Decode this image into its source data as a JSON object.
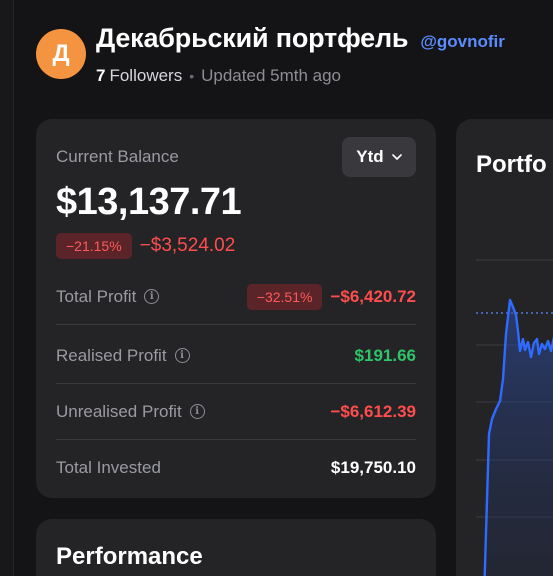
{
  "profile": {
    "avatar_letter": "Д",
    "avatar_color": "#f59440",
    "title": "Декабрьский портфель",
    "handle": "@govnofir",
    "followers_count": "7",
    "followers_label": "Followers",
    "updated": "Updated 5mth ago"
  },
  "balance": {
    "label": "Current Balance",
    "range_selected": "Ytd",
    "value": "$13,137.71",
    "change_pct": "−21.15%",
    "change_abs": "−$3,524.02"
  },
  "stats": [
    {
      "label": "Total Profit",
      "info": true,
      "badge": "−32.51%",
      "value": "−$6,420.72",
      "tone": "neg"
    },
    {
      "label": "Realised Profit",
      "info": true,
      "badge": "",
      "value": "$191.66",
      "tone": "pos"
    },
    {
      "label": "Unrealised Profit",
      "info": true,
      "badge": "",
      "value": "−$6,612.39",
      "tone": "neg"
    },
    {
      "label": "Total Invested",
      "info": false,
      "badge": "",
      "value": "$19,750.10",
      "tone": "white"
    }
  ],
  "performance": {
    "title": "Performance"
  },
  "portfolio_chart": {
    "title": "Portfo"
  },
  "colors": {
    "negative": "#ff4d4d",
    "positive": "#2ec46a",
    "accent": "#5b8cff",
    "line": "#2f6bff"
  }
}
